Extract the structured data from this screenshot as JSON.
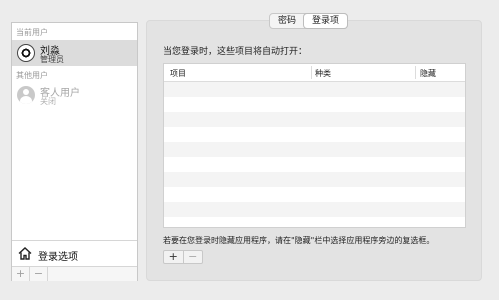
{
  "sidebar": {
    "current_user_header": "当前用户",
    "current_user": {
      "name": "刘淼",
      "role": "管理员"
    },
    "other_users_header": "其他用户",
    "other_users": [
      {
        "name": "客人用户",
        "role": "关闭"
      }
    ],
    "login_options_label": "登录选项",
    "add_symbol": "+",
    "remove_symbol": "−"
  },
  "tabs": [
    {
      "label": "密码",
      "active": false
    },
    {
      "label": "登录项",
      "active": true
    }
  ],
  "login_items": {
    "intro": "当您登录时，这些项目将自动打开：",
    "columns": [
      "项目",
      "种类",
      "隐藏"
    ],
    "rows": [],
    "hint": "若要在您登录时隐藏应用程序，请在\"隐藏\"栏中选择应用程序旁边的复选框。",
    "add_symbol": "+",
    "remove_symbol": "−"
  },
  "icons": {
    "current_user_avatar": "soccer-ball-avatar-icon",
    "guest_avatar": "guest-user-icon",
    "login_options": "home-icon"
  }
}
